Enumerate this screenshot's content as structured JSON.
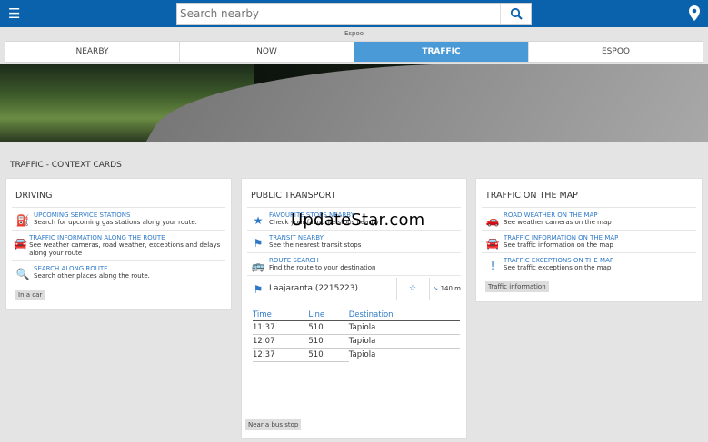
{
  "header": {
    "search_placeholder": "Search nearby",
    "city": "Espoo"
  },
  "tabs": [
    "NEARBY",
    "NOW",
    "TRAFFIC",
    "ESPOO"
  ],
  "section_title": "TRAFFIC - CONTEXT CARDS",
  "driving": {
    "title": "DRIVING",
    "items": [
      {
        "title": "UPCOMING SERVICE STATIONS",
        "desc": "Search for upcoming gas stations along your route."
      },
      {
        "title": "TRAFFIC INFORMATION ALONG THE ROUTE",
        "desc": "See weather cameras, road weather, exceptions and delays along your route"
      },
      {
        "title": "SEARCH ALONG ROUTE",
        "desc": "Search other places along the route."
      }
    ],
    "tag": "In a car"
  },
  "transport": {
    "title": "PUBLIC TRANSPORT",
    "items": [
      {
        "title": "FAVOURITE STOPS NEARBY",
        "desc": "Check your favourite stops nearby"
      },
      {
        "title": "TRANSIT NEARBY",
        "desc": "See the nearest transit stops"
      },
      {
        "title": "ROUTE SEARCH",
        "desc": "Find the route to your destination"
      }
    ],
    "stop_name": "Laajaranta (2215223)",
    "distance": "140 m",
    "columns": [
      "Time",
      "Line",
      "Destination"
    ],
    "rows": [
      [
        "11:37",
        "510",
        "Tapiola"
      ],
      [
        "12:07",
        "510",
        "Tapiola"
      ],
      [
        "12:37",
        "510",
        "Tapiola"
      ]
    ],
    "tag": "Near a bus stop"
  },
  "map": {
    "title": "TRAFFIC ON THE MAP",
    "items": [
      {
        "title": "ROAD WEATHER ON THE MAP",
        "desc": "See weather cameras on the map"
      },
      {
        "title": "TRAFFIC INFORMATION ON THE MAP",
        "desc": "See traffic information on the map"
      },
      {
        "title": "TRAFFIC EXCEPTIONS ON THE MAP",
        "desc": "See traffic exceptions on the map"
      }
    ],
    "tag": "Traffic information"
  },
  "watermark": "UpdateStar.com"
}
